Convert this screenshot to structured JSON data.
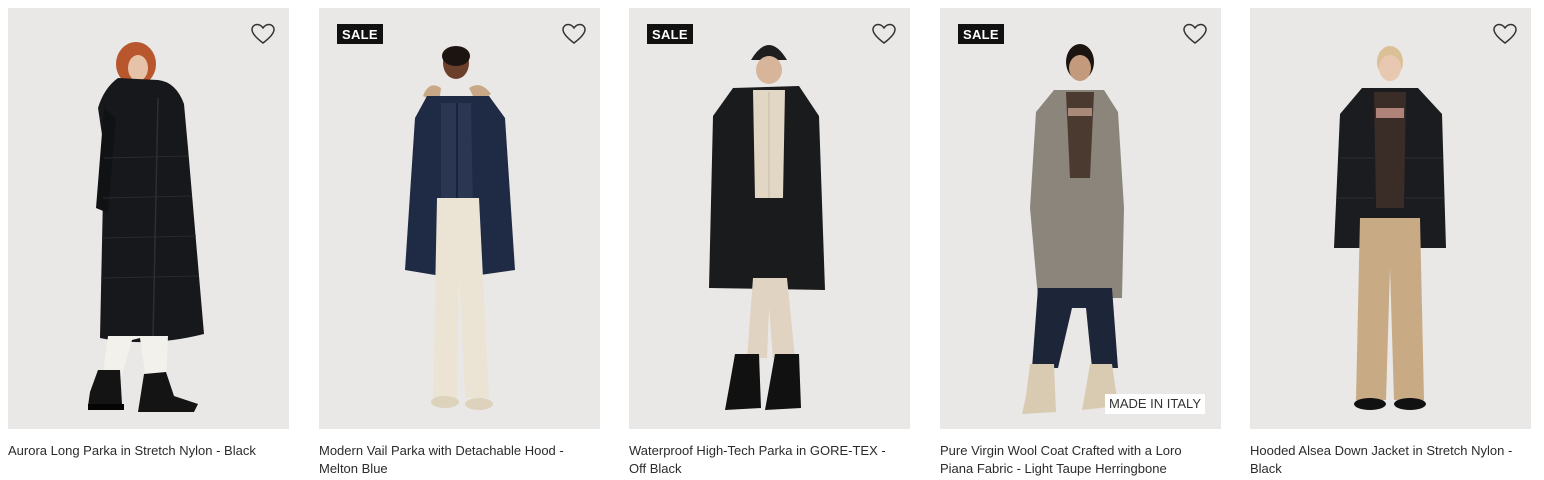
{
  "products": [
    {
      "name": "Aurora Long Parka in Stretch Nylon - Black",
      "badge": "",
      "tag": "",
      "wishlist_icon": "heart-outline-icon"
    },
    {
      "name": "Modern Vail Parka with Detachable Hood - Melton Blue",
      "badge": "SALE",
      "tag": "",
      "wishlist_icon": "heart-outline-icon"
    },
    {
      "name": "Waterproof High-Tech Parka in GORE-TEX - Off Black",
      "badge": "SALE",
      "tag": "",
      "wishlist_icon": "heart-outline-icon"
    },
    {
      "name": "Pure Virgin Wool Coat Crafted with a Loro Piana Fabric - Light Taupe Herringbone",
      "badge": "SALE",
      "tag": "MADE IN ITALY",
      "wishlist_icon": "heart-outline-icon"
    },
    {
      "name": "Hooded Alsea Down Jacket in Stretch Nylon - Black",
      "badge": "",
      "tag": "",
      "wishlist_icon": "heart-outline-icon"
    }
  ],
  "colors": {
    "image_bg": "#e9e8e6",
    "badge_bg": "#111111",
    "text": "#2b2b2b"
  }
}
